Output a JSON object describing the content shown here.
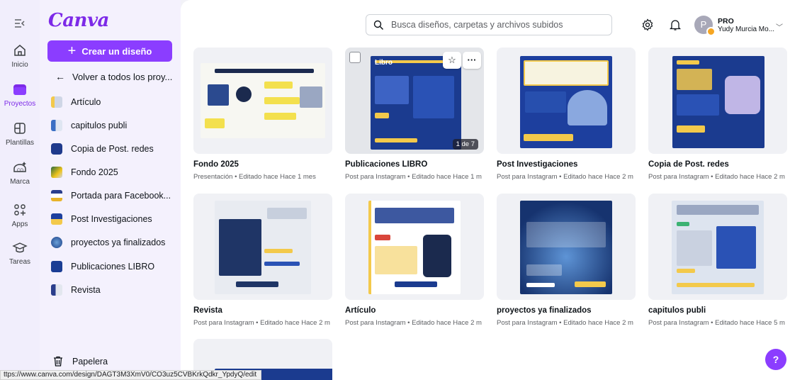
{
  "rail": {
    "items": [
      {
        "label": "Inicio",
        "icon": "home-icon"
      },
      {
        "label": "Proyectos",
        "icon": "folder-icon"
      },
      {
        "label": "Plantillas",
        "icon": "templates-icon"
      },
      {
        "label": "Marca",
        "icon": "brand-icon"
      },
      {
        "label": "Apps",
        "icon": "apps-icon"
      },
      {
        "label": "Tareas",
        "icon": "tasks-icon"
      }
    ]
  },
  "panel": {
    "logo": "Canva",
    "create_label": "Crear un diseño",
    "back_label": "Volver a todos los proy...",
    "folders": [
      {
        "label": "Artículo"
      },
      {
        "label": "capitulos publi"
      },
      {
        "label": "Copia de Post. redes"
      },
      {
        "label": "Fondo 2025"
      },
      {
        "label": "Portada para Facebook..."
      },
      {
        "label": "Post Investigaciones"
      },
      {
        "label": "proyectos ya finalizados"
      },
      {
        "label": "Publicaciones LIBRO"
      },
      {
        "label": "Revista"
      }
    ],
    "trash_label": "Papelera"
  },
  "header": {
    "search_placeholder": "Busca diseños, carpetas y archivos subidos",
    "account_plan": "PRO",
    "account_name": "Yudy Murcia Mo...",
    "avatar_initial": "P"
  },
  "designs": [
    {
      "title": "Fondo 2025",
      "meta": "Presentación • Editado hace Hace 1 mes"
    },
    {
      "title": "Publicaciones LIBRO",
      "meta": "Post para Instagram • Editado hace Hace 1 m",
      "pages": "1 de 7",
      "thumb_heading": "Libro"
    },
    {
      "title": "Post Investigaciones",
      "meta": "Post para Instagram • Editado hace Hace 2 m"
    },
    {
      "title": "Copia de Post. redes",
      "meta": "Post para Instagram • Editado hace Hace 2 m"
    },
    {
      "title": "Revista",
      "meta": "Post para Instagram • Editado hace Hace 2 m"
    },
    {
      "title": "Artículo",
      "meta": "Post para Instagram • Editado hace Hace 2 m"
    },
    {
      "title": "proyectos ya finalizados",
      "meta": "Post para Instagram • Editado hace Hace 2 m"
    },
    {
      "title": "capitulos publi",
      "meta": "Post para Instagram • Editado hace Hace 5 m"
    }
  ],
  "status_url": "ttps://www.canva.com/design/DAGT3M3XmV0/CO3uz5CVBKrkQdkr_YpdyQ/edit",
  "help_label": "?",
  "colors": {
    "brand": "#8b3dff",
    "rail": "#f1eefc",
    "panel": "#f4f1fd"
  }
}
